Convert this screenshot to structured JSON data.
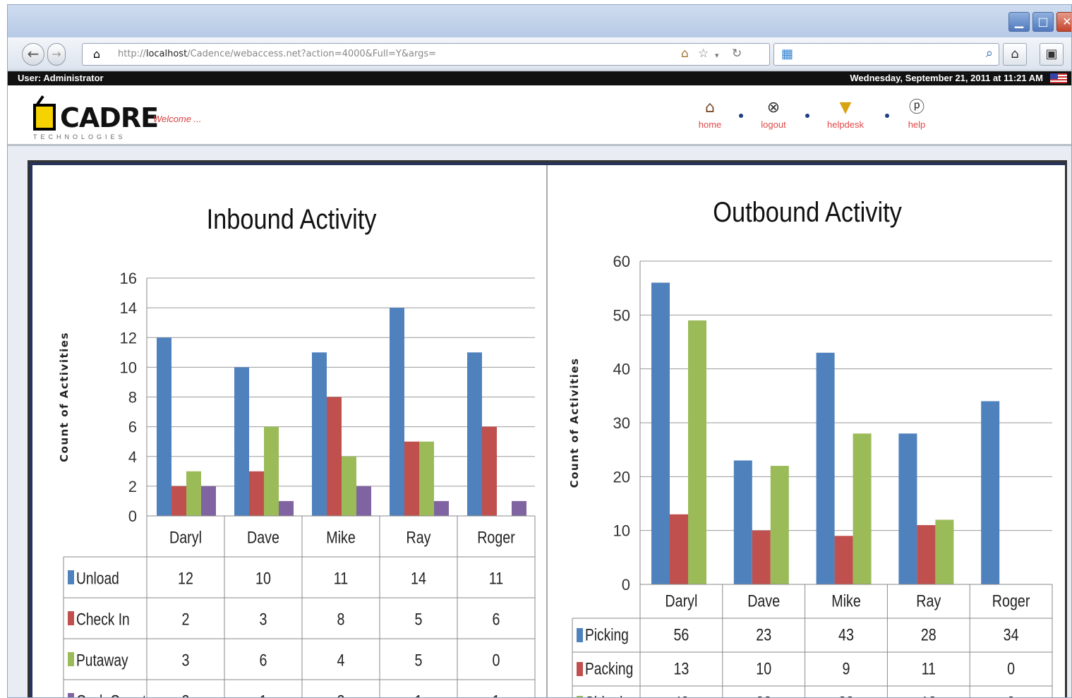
{
  "browser": {
    "url_prefix": "http://",
    "url_host": "localhost",
    "url_path": "/Cadence/webaccess.net?action=4000&Full=Y&args=",
    "minimize_glyph": "▁",
    "maximize_glyph": "□",
    "close_glyph": "✕"
  },
  "status_bar": {
    "user": "User: Administrator",
    "datetime": "Wednesday, September 21, 2011 at 11:21 AM"
  },
  "header": {
    "logo_name": "CADRE",
    "logo_sub": "TECHNOLOGIES",
    "welcome": "Welcome ...",
    "nav": [
      {
        "label": "home",
        "icon": "house-icon"
      },
      {
        "label": "logout",
        "icon": "logout-icon"
      },
      {
        "label": "helpdesk",
        "icon": "lightbulb-icon"
      },
      {
        "label": "help",
        "icon": "help-bubble-icon"
      }
    ]
  },
  "chart_data": [
    {
      "type": "bar",
      "title": "Inbound Activity",
      "ylabel": "Count of Activities",
      "xlabel": "",
      "ylim": [
        0,
        16
      ],
      "yticks": [
        0,
        2,
        4,
        6,
        8,
        10,
        12,
        14,
        16
      ],
      "categories": [
        "Daryl",
        "Dave",
        "Mike",
        "Ray",
        "Roger"
      ],
      "grid": true,
      "legend": "data-table",
      "series": [
        {
          "name": "Unload",
          "color": "#4f81bd",
          "values": [
            12,
            10,
            11,
            14,
            11
          ]
        },
        {
          "name": "Check In",
          "color": "#c0504d",
          "values": [
            2,
            3,
            8,
            5,
            6
          ]
        },
        {
          "name": "Putaway",
          "color": "#9bbb59",
          "values": [
            3,
            6,
            4,
            5,
            0
          ]
        },
        {
          "name": "CycleCount",
          "color": "#8064a2",
          "values": [
            2,
            1,
            2,
            1,
            1
          ]
        }
      ]
    },
    {
      "type": "bar",
      "title": "Outbound Activity",
      "ylabel": "Count of Activities",
      "xlabel": "",
      "ylim": [
        0,
        60
      ],
      "yticks": [
        0,
        10,
        20,
        30,
        40,
        50,
        60
      ],
      "categories": [
        "Daryl",
        "Dave",
        "Mike",
        "Ray",
        "Roger"
      ],
      "grid": true,
      "legend": "data-table",
      "series": [
        {
          "name": "Picking",
          "color": "#4f81bd",
          "values": [
            56,
            23,
            43,
            28,
            34
          ]
        },
        {
          "name": "Packing",
          "color": "#c0504d",
          "values": [
            13,
            10,
            9,
            11,
            0
          ]
        },
        {
          "name": "Shipping",
          "color": "#9bbb59",
          "values": [
            49,
            22,
            28,
            12,
            0
          ]
        }
      ]
    }
  ]
}
